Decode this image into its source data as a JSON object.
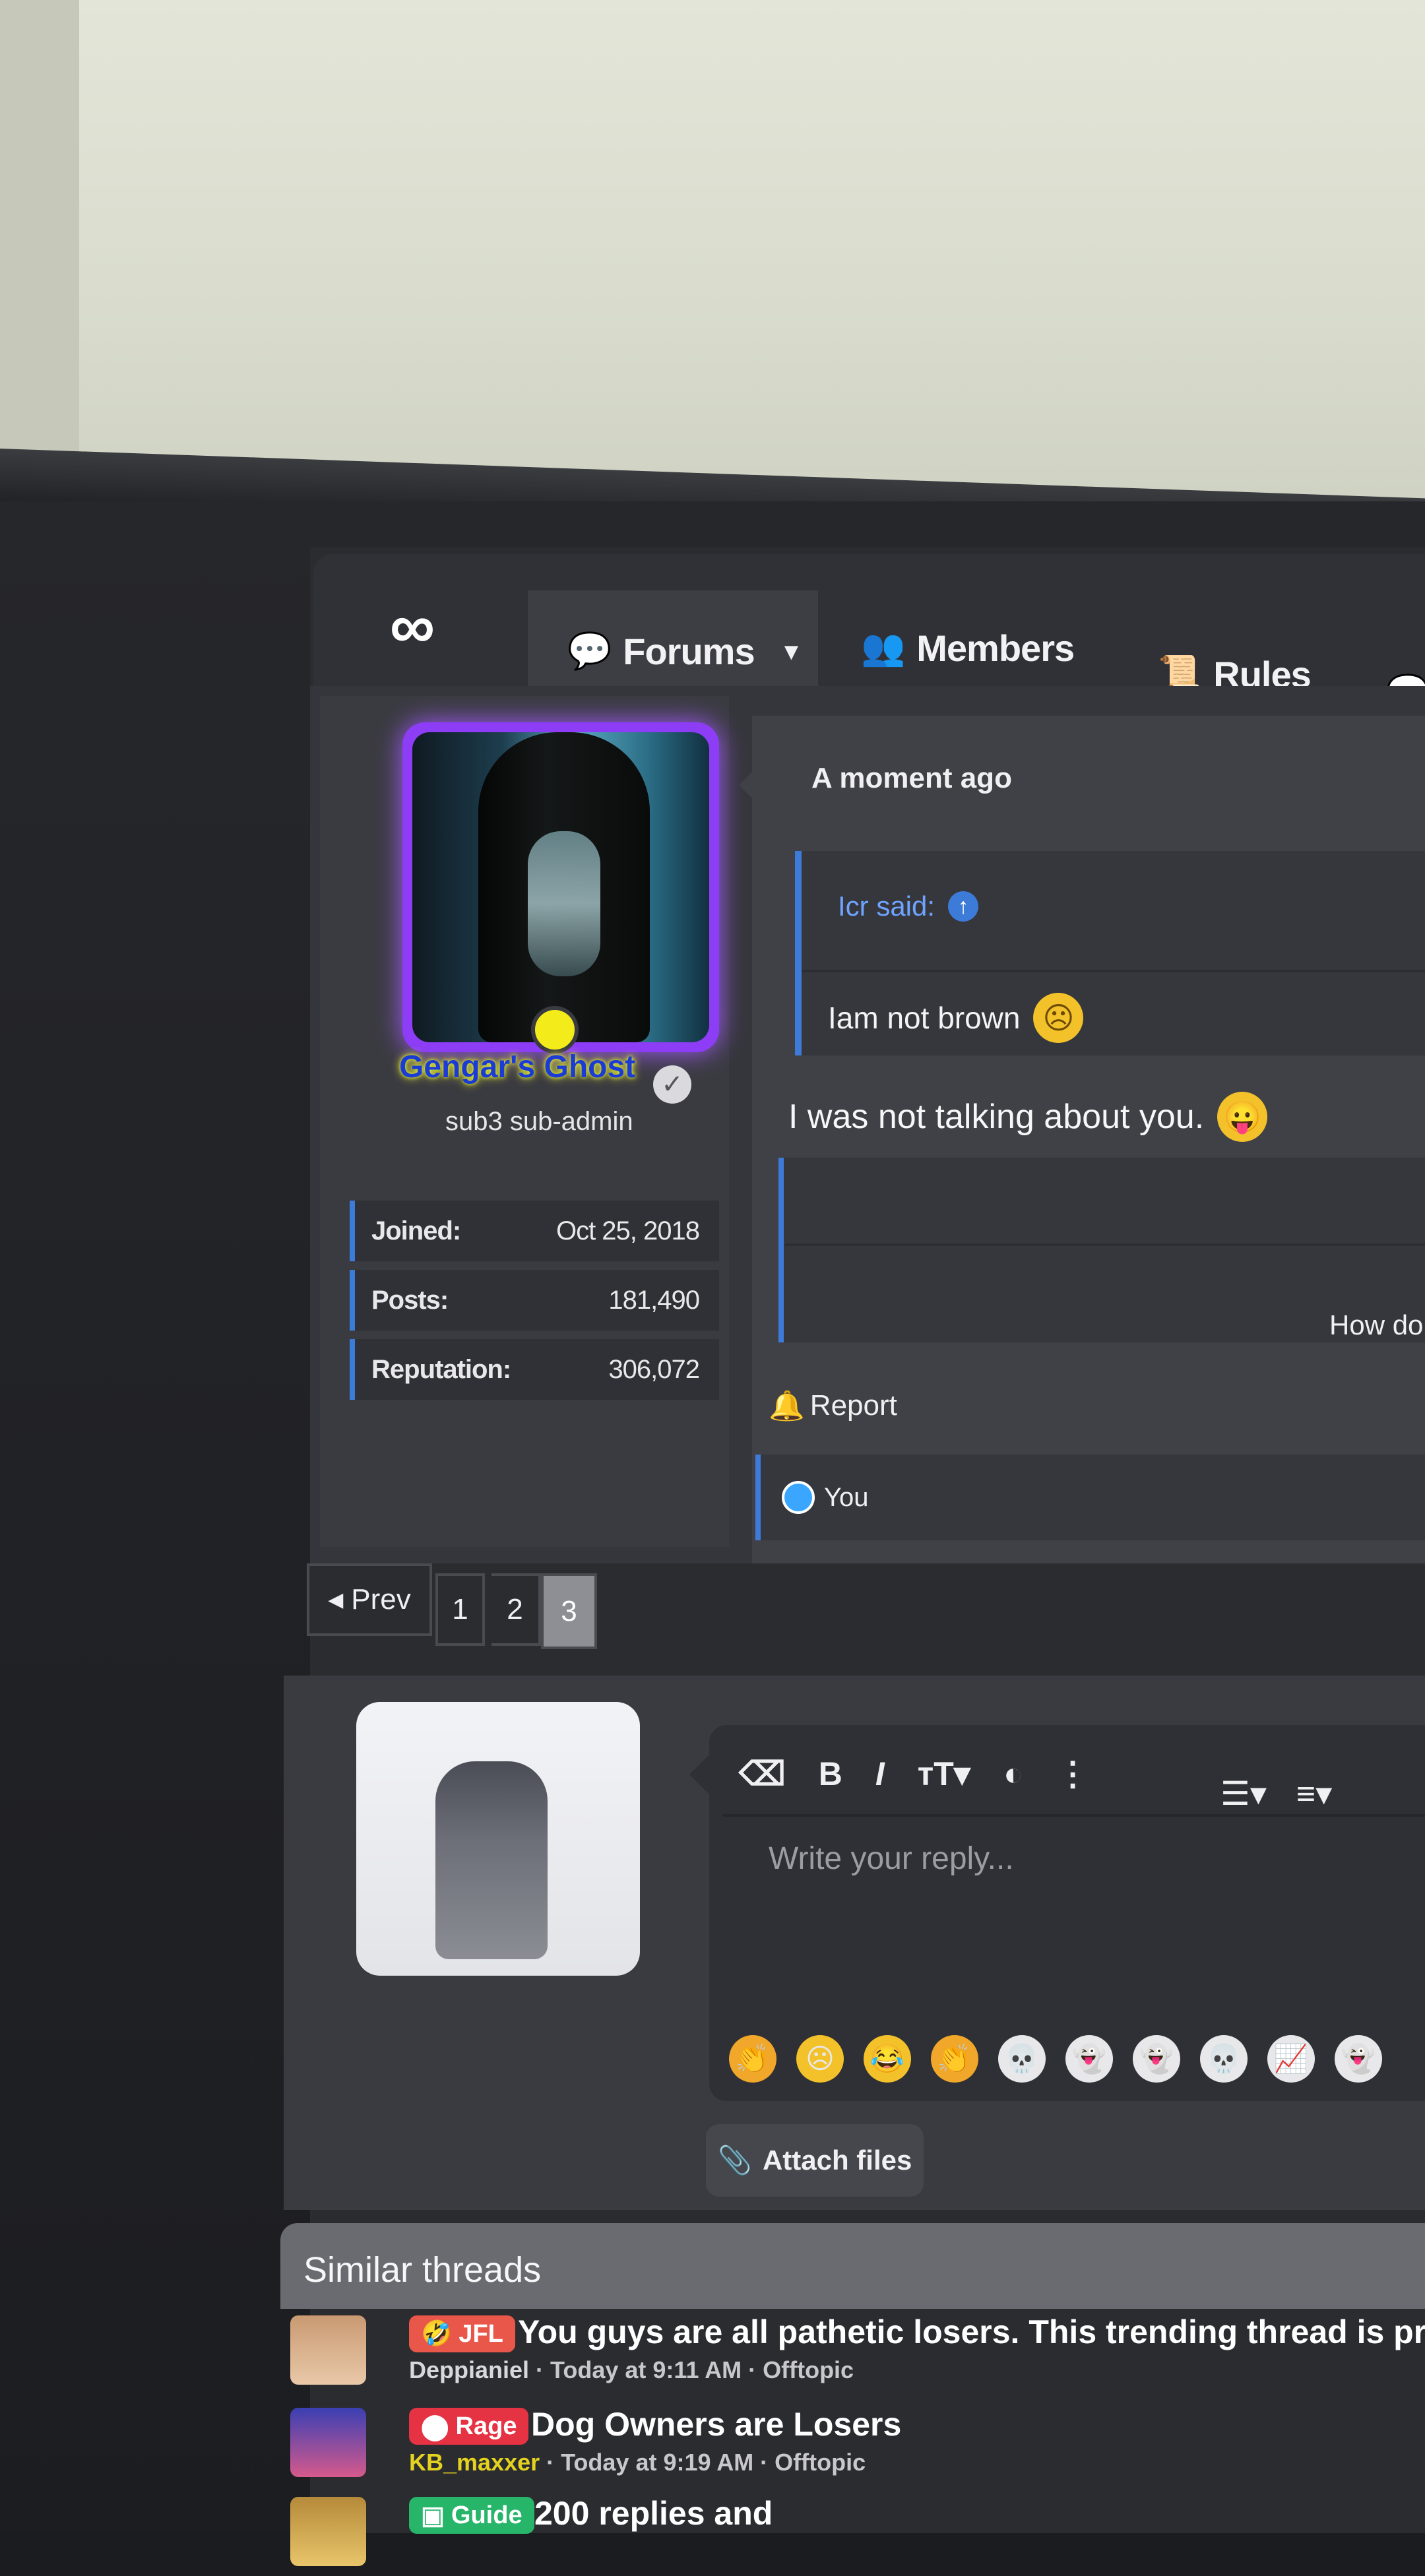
{
  "nav": {
    "forums": "Forums",
    "members": "Members",
    "rules": "Rules"
  },
  "post": {
    "username": "Gengar's Ghost",
    "user_title": "sub3 sub-admin",
    "stats": [
      {
        "label": "Joined:",
        "value": "Oct 25, 2018"
      },
      {
        "label": "Posts:",
        "value": "181,490"
      },
      {
        "label": "Reputation:",
        "value": "306,072"
      }
    ],
    "timestamp": "A moment ago",
    "quote_author": "Icr said:",
    "quote_text": "Iam not brown",
    "body": "I was not talking about you.",
    "signature_text": "How do",
    "report": "Report",
    "reaction_user": "You"
  },
  "pagination": {
    "prev": "Prev",
    "pages": [
      "1",
      "2",
      "3"
    ],
    "current": "3"
  },
  "reply": {
    "placeholder": "Write your reply...",
    "attach": "Attach files"
  },
  "similar": {
    "title": "Similar threads",
    "threads": [
      {
        "tag": "JFL",
        "tag_color": "#e8574a",
        "title": "You guys are all pathetic losers. This trending thread is proof",
        "author": "Deppianiel",
        "meta": " · Today at 9:11 AM · Offtopic"
      },
      {
        "tag": "Rage",
        "tag_color": "#e53344",
        "title": "Dog Owners are Losers",
        "author": "KB_maxxer",
        "meta": " · Today at 9:19 AM · Offtopic"
      },
      {
        "tag": "Guide",
        "tag_color": "#27b56a",
        "title": "200 replies and",
        "author": "",
        "meta": ""
      }
    ]
  }
}
